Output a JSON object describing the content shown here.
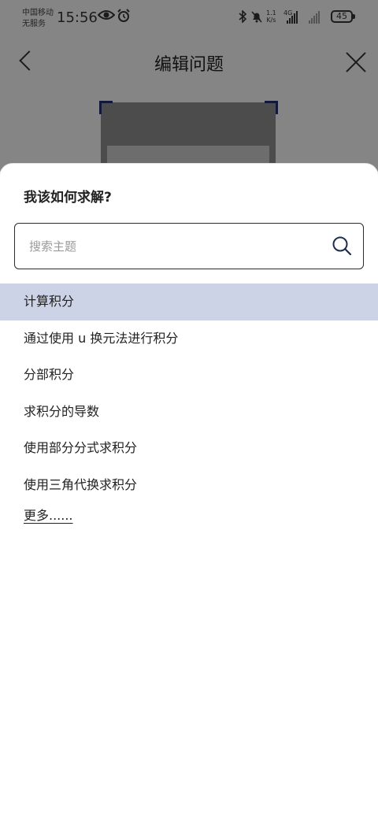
{
  "status_bar": {
    "carrier_line1": "中国移动",
    "carrier_line2": "无服务",
    "time": "15:56",
    "net_speed_value": "1.1",
    "net_speed_unit": "K/s",
    "network_type": "4G",
    "battery": "45"
  },
  "header": {
    "title": "编辑问题"
  },
  "sheet": {
    "title": "我该如何求解?",
    "search": {
      "placeholder": "搜索主题",
      "value": ""
    },
    "options": [
      {
        "label": "计算积分",
        "selected": true
      },
      {
        "label": "通过使用 u 换元法进行积分",
        "selected": false
      },
      {
        "label": "分部积分",
        "selected": false
      },
      {
        "label": "求积分的导数",
        "selected": false
      },
      {
        "label": "使用部分分式求积分",
        "selected": false
      },
      {
        "label": "使用三角代换求积分",
        "selected": false
      }
    ],
    "more_label": "更多......"
  },
  "colors": {
    "selected_bg": "#cdd3e6",
    "crop_corner": "#1f2d6b"
  }
}
